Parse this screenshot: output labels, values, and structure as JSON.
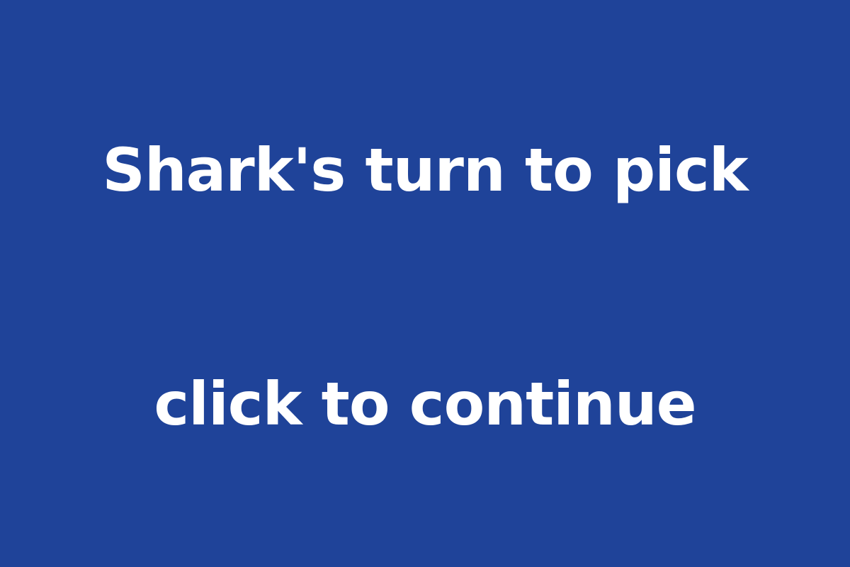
{
  "screen": {
    "background_color": "#1f4399",
    "text_color": "#ffffff",
    "turn_message": "Shark's turn to pick",
    "continue_prompt": "click to continue"
  }
}
